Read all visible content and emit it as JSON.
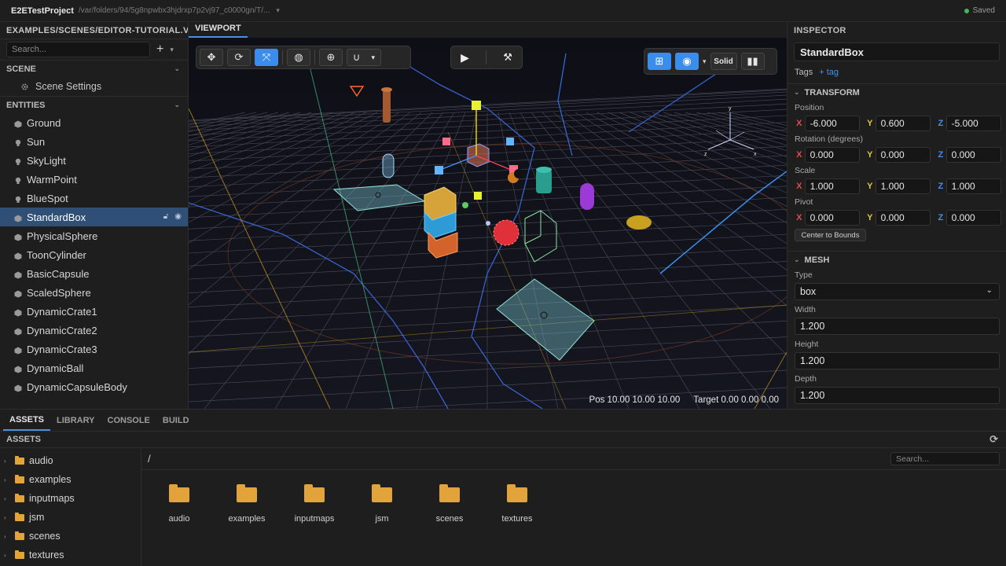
{
  "titlebar": {
    "project": "E2ETestProject",
    "path": "/var/folders/94/5g8npwbx3hjdrxp7p2vj97_c0000gn/T/...",
    "status": "Saved",
    "status_color": "#3fb950"
  },
  "left": {
    "scene_file": "EXAMPLES/SCENES/EDITOR-TUTORIAL.VS",
    "search_placeholder": "Search...",
    "add_label": "+",
    "scene_header": "SCENE",
    "scene_settings": "Scene Settings",
    "entities_header": "ENTITIES",
    "entities": [
      {
        "label": "Ground",
        "icon": "mesh-icon"
      },
      {
        "label": "Sun",
        "icon": "light-icon"
      },
      {
        "label": "SkyLight",
        "icon": "light-icon"
      },
      {
        "label": "WarmPoint",
        "icon": "light-icon"
      },
      {
        "label": "BlueSpot",
        "icon": "light-icon"
      },
      {
        "label": "StandardBox",
        "icon": "mesh-icon",
        "selected": true
      },
      {
        "label": "PhysicalSphere",
        "icon": "mesh-icon"
      },
      {
        "label": "ToonCylinder",
        "icon": "mesh-icon"
      },
      {
        "label": "BasicCapsule",
        "icon": "mesh-icon"
      },
      {
        "label": "ScaledSphere",
        "icon": "mesh-icon"
      },
      {
        "label": "DynamicCrate1",
        "icon": "mesh-icon"
      },
      {
        "label": "DynamicCrate2",
        "icon": "mesh-icon"
      },
      {
        "label": "DynamicCrate3",
        "icon": "mesh-icon"
      },
      {
        "label": "DynamicBall",
        "icon": "mesh-icon"
      },
      {
        "label": "DynamicCapsuleBody",
        "icon": "mesh-icon"
      }
    ]
  },
  "viewport": {
    "tab": "VIEWPORT",
    "toolbar": {
      "move": "move-icon",
      "rotate": "rotate-icon",
      "scale": "scale-icon",
      "space": "globe-icon",
      "pivot": "crosshair-icon",
      "snap": "magnet-icon"
    },
    "play": "play-icon",
    "build": "hammer-icon",
    "render_mode": "Solid",
    "info_pos": "Pos 10.00 10.00 10.00",
    "info_target": "Target 0.00 0.00 0.00"
  },
  "inspector": {
    "title": "INSPECTOR",
    "name": "StandardBox",
    "tags_label": "Tags",
    "add_tag": "+ tag",
    "transform_header": "TRANSFORM",
    "position_label": "Position",
    "position": {
      "x": "-6.000",
      "y": "0.600",
      "z": "-5.000"
    },
    "rotation_label": "Rotation (degrees)",
    "rotation": {
      "x": "0.000",
      "y": "0.000",
      "z": "0.000"
    },
    "scale_label": "Scale",
    "scale": {
      "x": "1.000",
      "y": "1.000",
      "z": "1.000"
    },
    "pivot_label": "Pivot",
    "pivot": {
      "x": "0.000",
      "y": "0.000",
      "z": "0.000"
    },
    "axis_x": "X",
    "axis_y": "Y",
    "axis_z": "Z",
    "center_bounds": "Center to Bounds",
    "mesh_header": "MESH",
    "type_label": "Type",
    "type_value": "box",
    "width_label": "Width",
    "width": "1.200",
    "height_label": "Height",
    "height": "1.200",
    "depth_label": "Depth",
    "depth": "1.200"
  },
  "bottom": {
    "tabs": [
      "ASSETS",
      "LIBRARY",
      "CONSOLE",
      "BUILD"
    ],
    "assets_header": "ASSETS",
    "path": "/",
    "search_placeholder": "Search...",
    "folders": [
      "audio",
      "examples",
      "inputmaps",
      "jsm",
      "scenes",
      "textures"
    ]
  },
  "colors": {
    "accent": "#4a90e2",
    "selection": "#2f4f77",
    "folder": "#e3a33b"
  }
}
